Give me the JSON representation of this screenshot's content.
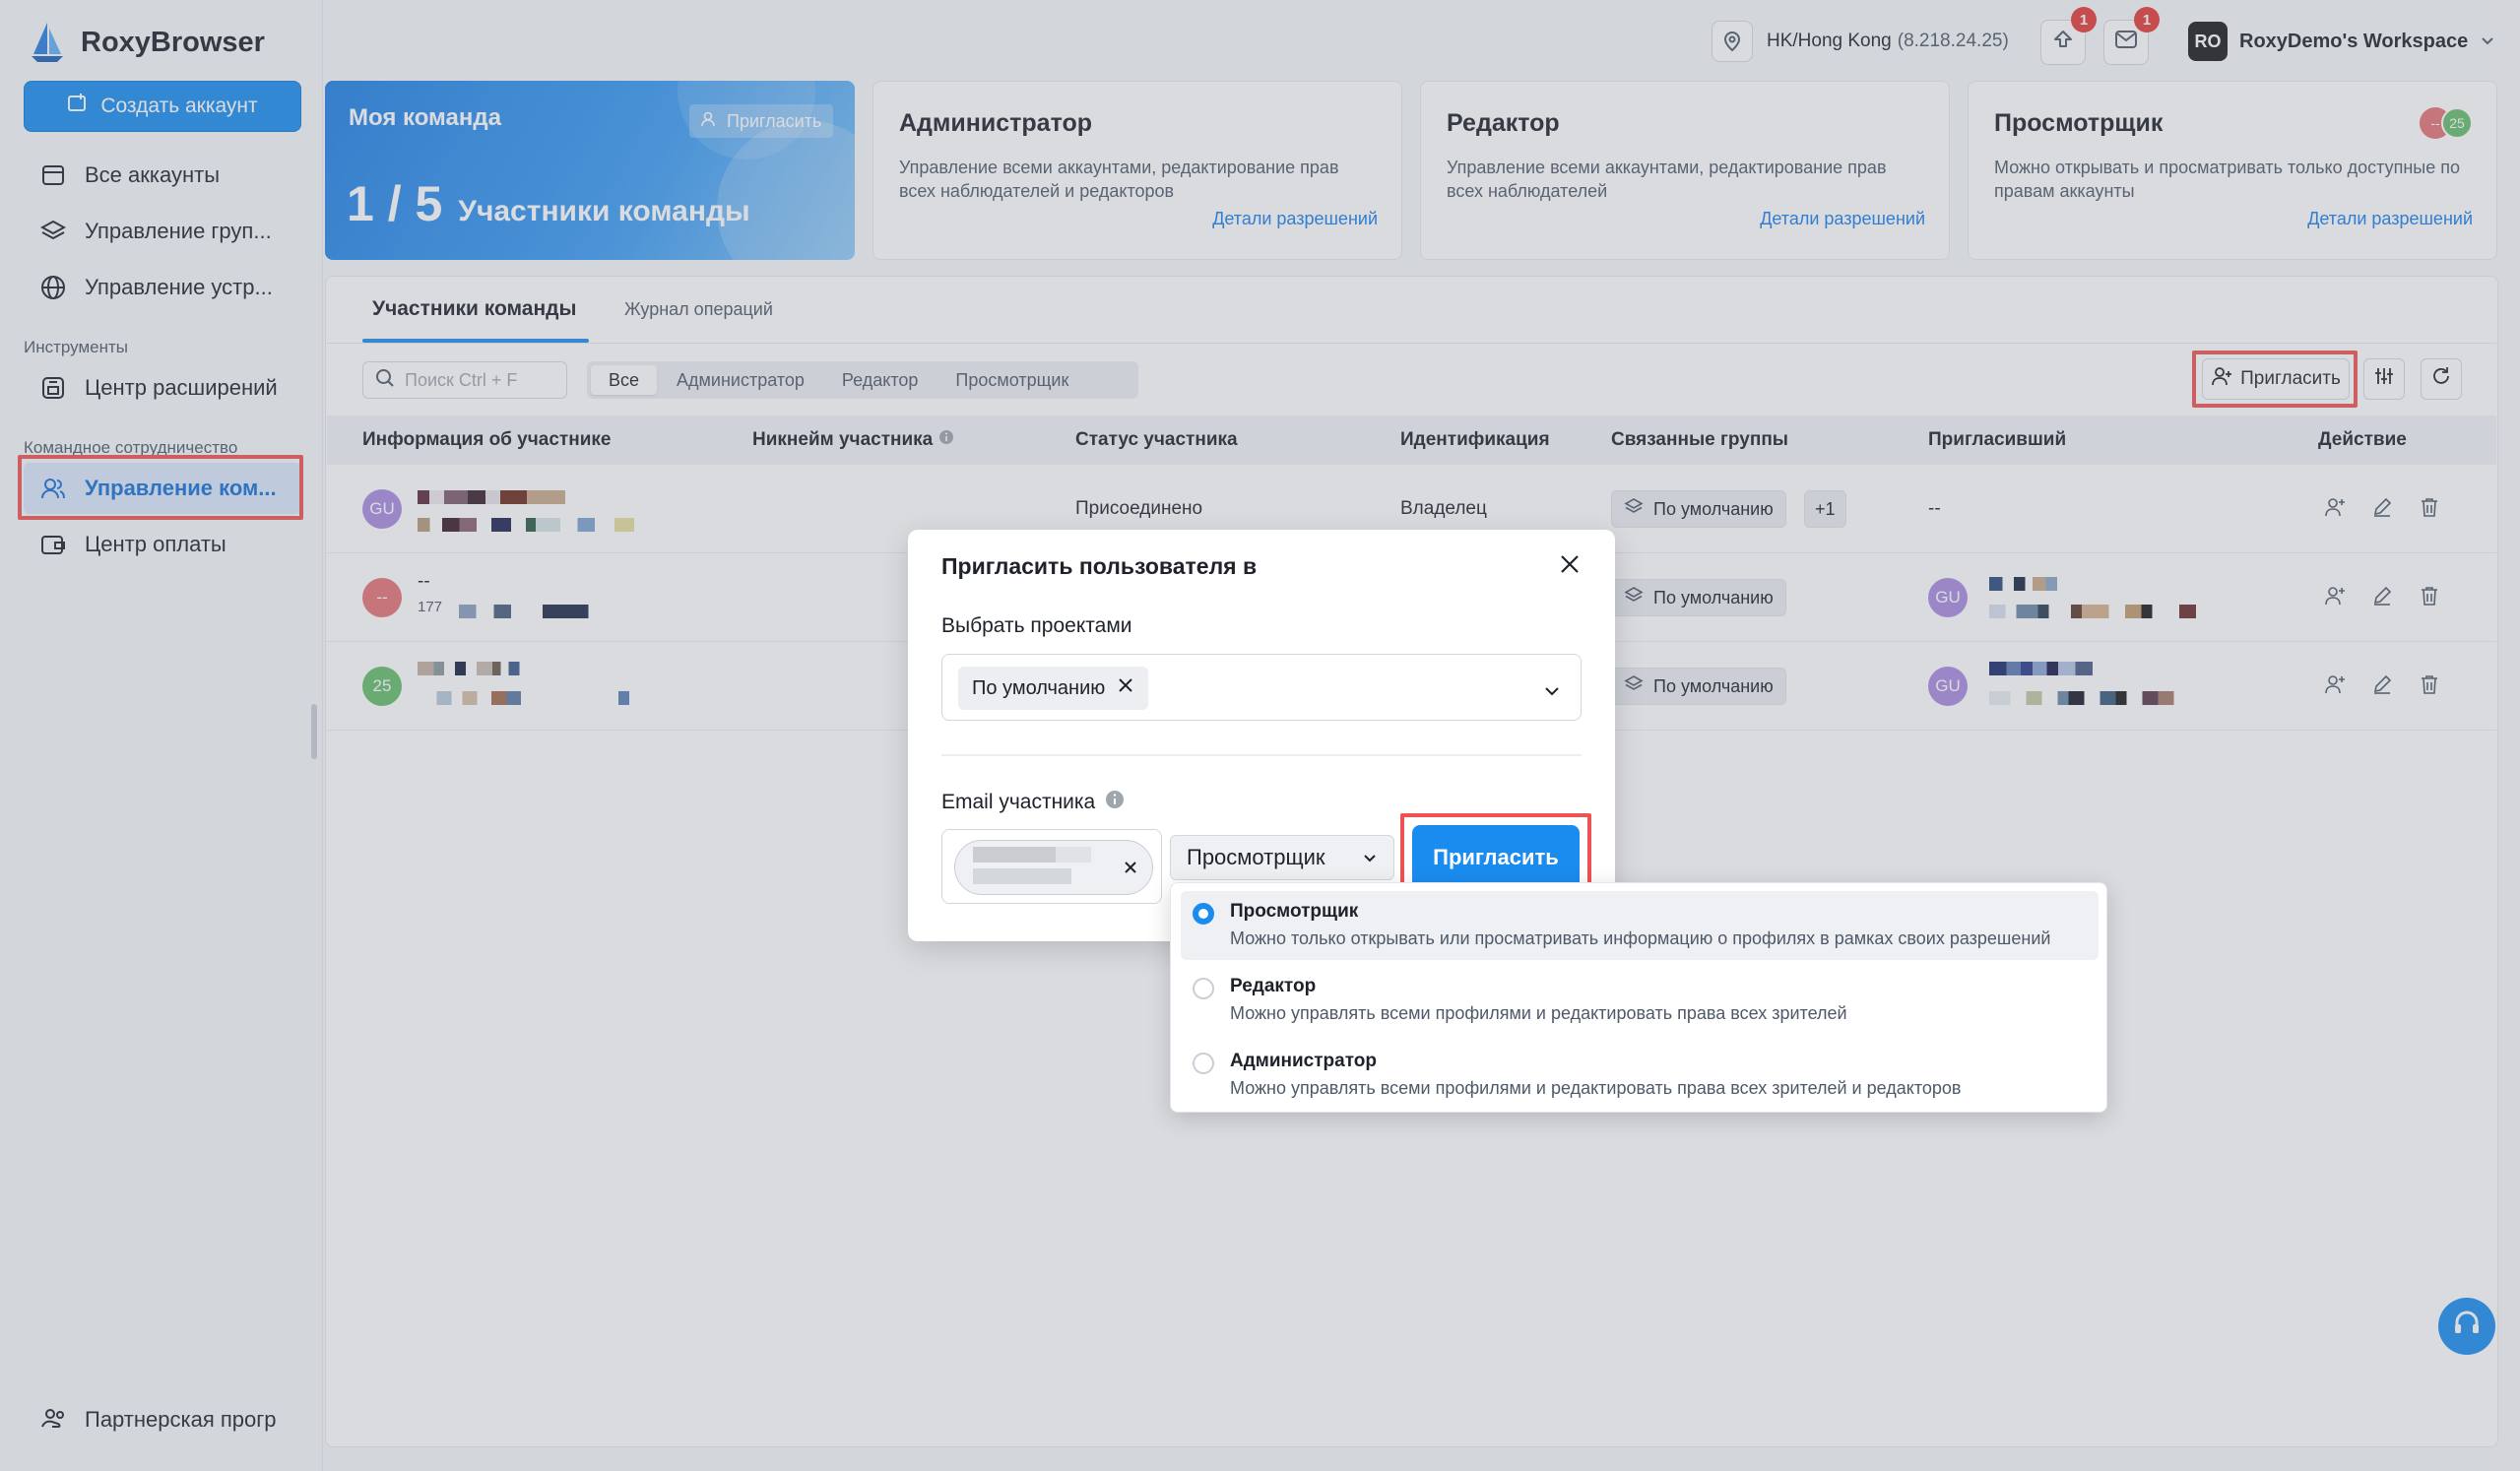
{
  "app": {
    "name": "RoxyBrowser"
  },
  "sidebar": {
    "create_button": "Создать аккаунт",
    "items": [
      {
        "label": "Все аккаунты",
        "icon": "window-icon"
      },
      {
        "label": "Управление груп...",
        "icon": "layers-icon"
      },
      {
        "label": "Управление устр...",
        "icon": "globe-icon"
      }
    ],
    "section_tools": "Инструменты",
    "tools_items": [
      {
        "label": "Центр расширений",
        "icon": "extension-icon"
      }
    ],
    "section_team": "Командное сотрудничество",
    "team_items": [
      {
        "label": "Управление ком...",
        "icon": "users-icon",
        "active": true
      },
      {
        "label": "Центр оплаты",
        "icon": "wallet-icon"
      }
    ],
    "partner": "Партнерская прогр"
  },
  "header": {
    "location": "HK/Hong Kong",
    "ip": "(8.218.24.25)",
    "upload_badge": "1",
    "mail_badge": "1",
    "workspace_avatar": "RO",
    "workspace_name": "RoxyDemo's Workspace"
  },
  "cards": {
    "team": {
      "title": "Моя команда",
      "invite": "Пригласить",
      "count": "1 / 5",
      "count_label": "Участники команды"
    },
    "admin": {
      "title": "Администратор",
      "desc": "Управление всеми аккаунтами, редактирование прав всех наблюдателей и редакторов",
      "link": "Детали разрешений"
    },
    "editor": {
      "title": "Редактор",
      "desc": "Управление всеми аккаунтами, редактирование прав всех наблюдателей",
      "link": "Детали разрешений"
    },
    "viewer": {
      "title": "Просмотрщик",
      "desc": "Можно открывать и просматривать только доступные по правам аккаунты",
      "link": "Детали разрешений",
      "avatar1": "--",
      "avatar2": "25"
    }
  },
  "tabs": {
    "members": "Участники команды",
    "log": "Журнал операций"
  },
  "filters": {
    "search_placeholder": "Поиск Ctrl + F",
    "segments": [
      "Все",
      "Администратор",
      "Редактор",
      "Просмотрщик"
    ],
    "invite_button": "Пригласить"
  },
  "table": {
    "headers": [
      "Информация об участнике",
      "Никнейм участника",
      "Статус участника",
      "Идентификация",
      "Связанные группы",
      "Пригласивший",
      "Действие"
    ],
    "rows": [
      {
        "avatar": "GU",
        "avatar_color": "#a98be0",
        "status": "Присоединено",
        "role": "Владелец",
        "group": "По умолчанию",
        "extra_groups": "+1",
        "inviter": "--"
      },
      {
        "avatar": "--",
        "avatar_color": "#e57373",
        "name": "--",
        "sub": "177",
        "group": "По умолчанию",
        "inviter_avatar": "GU"
      },
      {
        "avatar": "25",
        "avatar_color": "#66bb6a",
        "group": "По умолчанию",
        "inviter_avatar": "GU"
      }
    ]
  },
  "modal": {
    "title": "Пригласить пользователя в",
    "projects_label": "Выбрать проектами",
    "selected_project": "По умолчанию",
    "email_label": "Email участника",
    "role_value": "Просмотрщик",
    "invite_button": "Пригласить"
  },
  "dropdown": {
    "options": [
      {
        "title": "Просмотрщик",
        "desc": "Можно только открывать или просматривать информацию о профилях в рамках своих разрешений",
        "selected": true
      },
      {
        "title": "Редактор",
        "desc": "Можно управлять всеми профилями и редактировать права всех зрителей",
        "selected": false
      },
      {
        "title": "Администратор",
        "desc": "Можно управлять всеми профилями и редактировать права всех зрителей и редакторов",
        "selected": false
      }
    ]
  },
  "colors": {
    "accent": "#1a8cf0",
    "highlight": "#ef5252",
    "active_bg": "#dbe8fb"
  }
}
